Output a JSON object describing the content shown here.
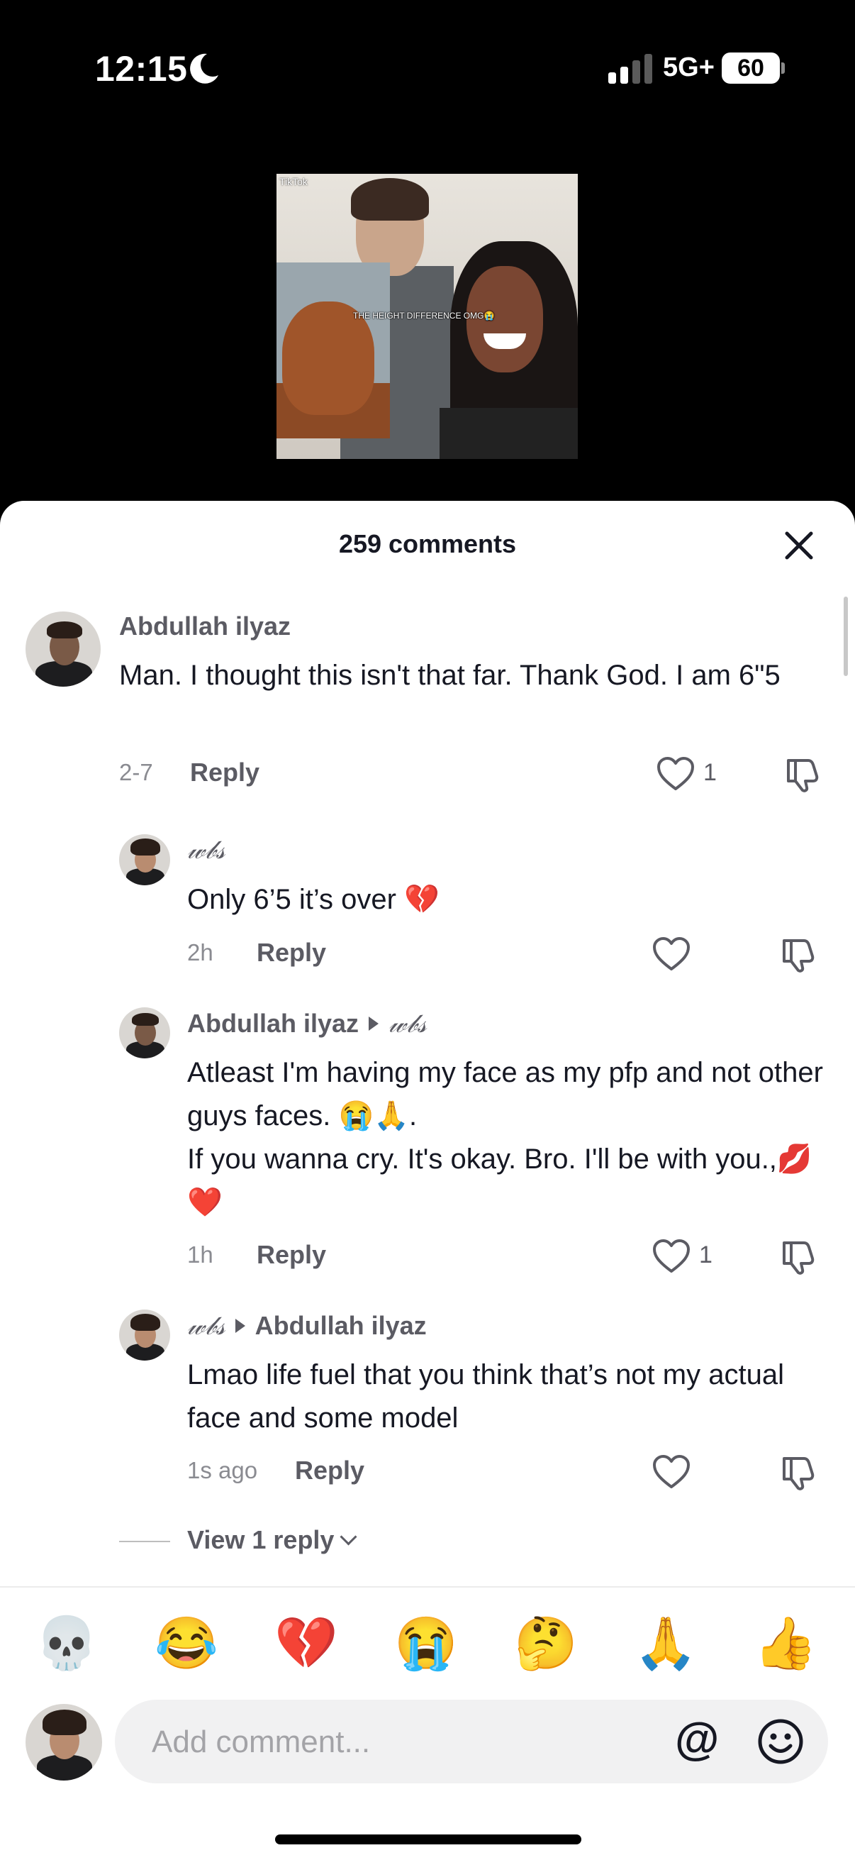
{
  "status_bar": {
    "time": "12:15",
    "network": "5G+",
    "battery": "60"
  },
  "video": {
    "caption": "THE HEIGHT DIFFERENCE OMG😭",
    "watermark": "TikTok"
  },
  "sheet": {
    "title": "259 comments"
  },
  "comments": [
    {
      "username": "Abdullah ilyaz",
      "text": "Man. I thought this isn't that far. Thank God. I am 6\"5",
      "time": "2-7",
      "reply_label": "Reply",
      "likes": "1"
    },
    {
      "username": "𝓌𝒷𝓈",
      "text": "Only 6’5 it’s over 💔",
      "time": "2h",
      "reply_label": "Reply"
    },
    {
      "username": "Abdullah ilyaz",
      "reply_to": "𝓌𝒷𝓈",
      "text_line1": "Atleast I'm having my face as my pfp and not other guys faces. 😭🙏.",
      "text_line2": "If you wanna cry. It's okay. Bro. I'll be with you.,💋 ❤️",
      "time": "1h",
      "reply_label": "Reply",
      "likes": "1"
    },
    {
      "username": "𝓌𝒷𝓈",
      "reply_to": "Abdullah ilyaz",
      "text": "Lmao life fuel that you think that’s not my actual face and some model",
      "time": "1s ago",
      "reply_label": "Reply"
    }
  ],
  "view_replies": "View 1 reply",
  "quick_emojis": [
    "💀",
    "😂",
    "💔",
    "😭",
    "🤔",
    "🙏",
    "👍"
  ],
  "composer": {
    "placeholder": "Add comment...",
    "mention": "@"
  }
}
